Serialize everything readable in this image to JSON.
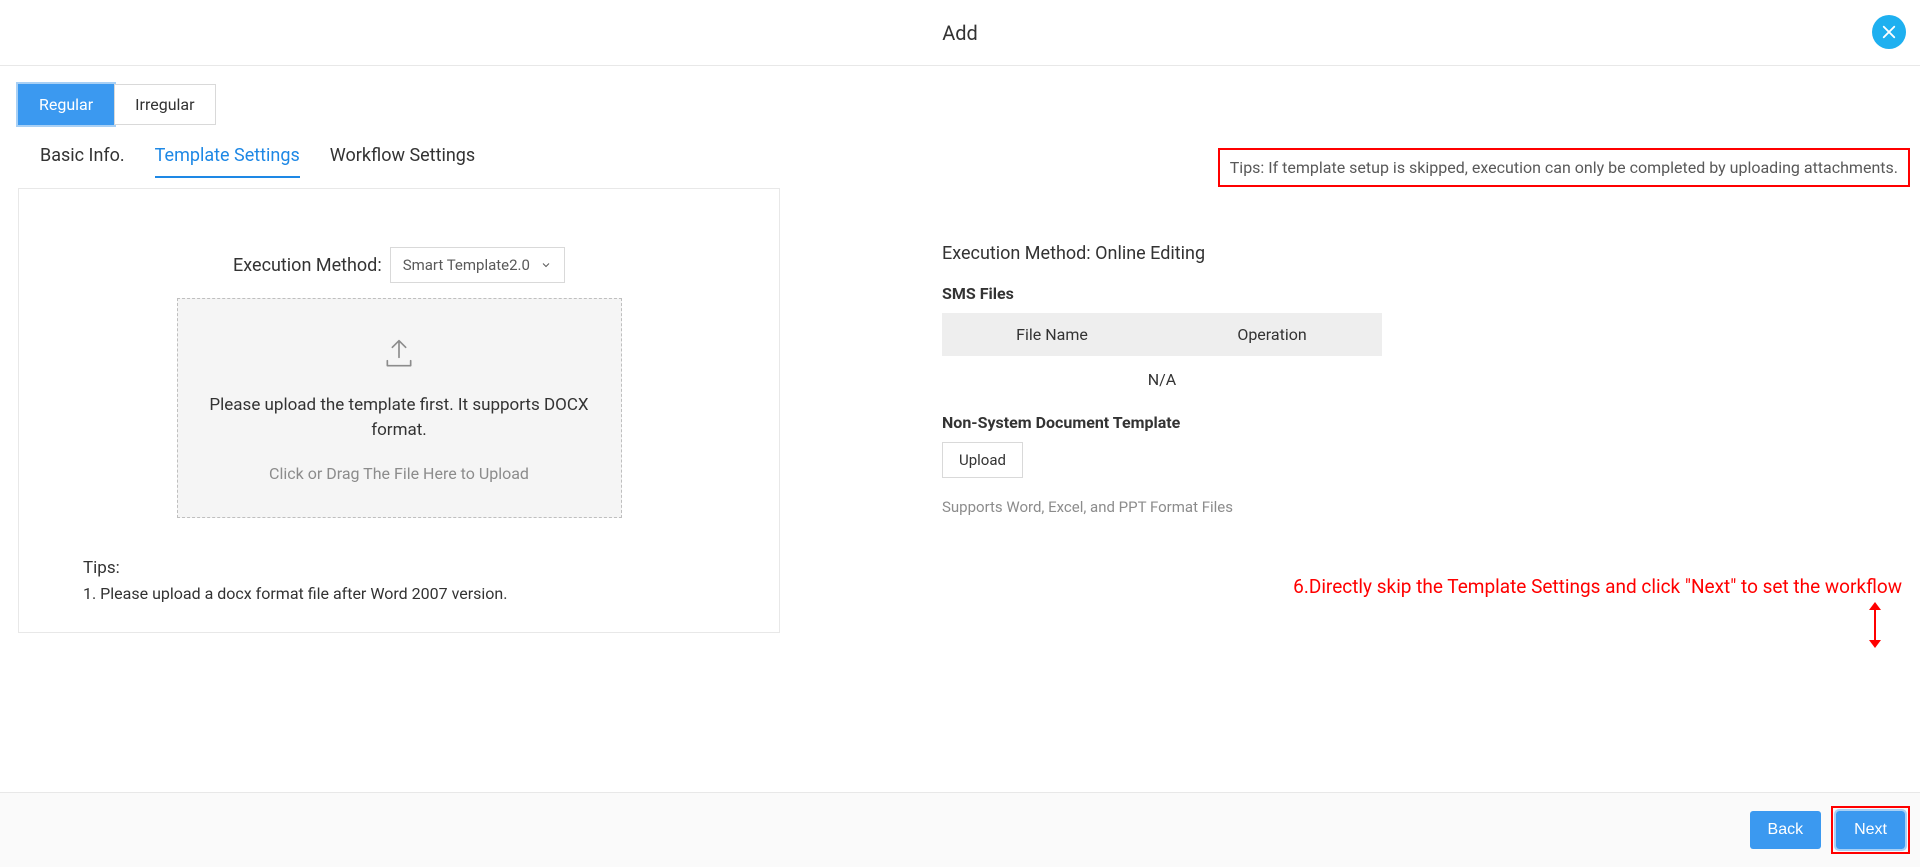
{
  "header": {
    "title": "Add"
  },
  "typeTabs": {
    "regular": "Regular",
    "irregular": "Irregular"
  },
  "subTabs": {
    "basicInfo": "Basic Info.",
    "templateSettings": "Template Settings",
    "workflowSettings": "Workflow Settings"
  },
  "topTip": "Tips: If template setup is skipped, execution can only be completed by uploading attachments.",
  "left": {
    "execLabel": "Execution Method:",
    "execValue": "Smart Template2.0",
    "uploadText1": "Please upload the template first. It supports DOCX format.",
    "uploadText2": "Click or Drag The File Here to Upload",
    "tipsLabel": "Tips:",
    "tipsItem1": "1. Please upload a docx format file after Word 2007 version."
  },
  "right": {
    "heading": "Execution Method: Online Editing",
    "smsFiles": "SMS Files",
    "colFileName": "File Name",
    "colOperation": "Operation",
    "emptyValue": "N/A",
    "nonSystemTitle": "Non-System Document Template",
    "uploadBtn": "Upload",
    "supportText": "Supports Word, Excel, and PPT Format Files"
  },
  "annotation": "6.Directly skip the Template Settings and click \"Next\" to set the workflow",
  "footer": {
    "back": "Back",
    "next": "Next"
  }
}
